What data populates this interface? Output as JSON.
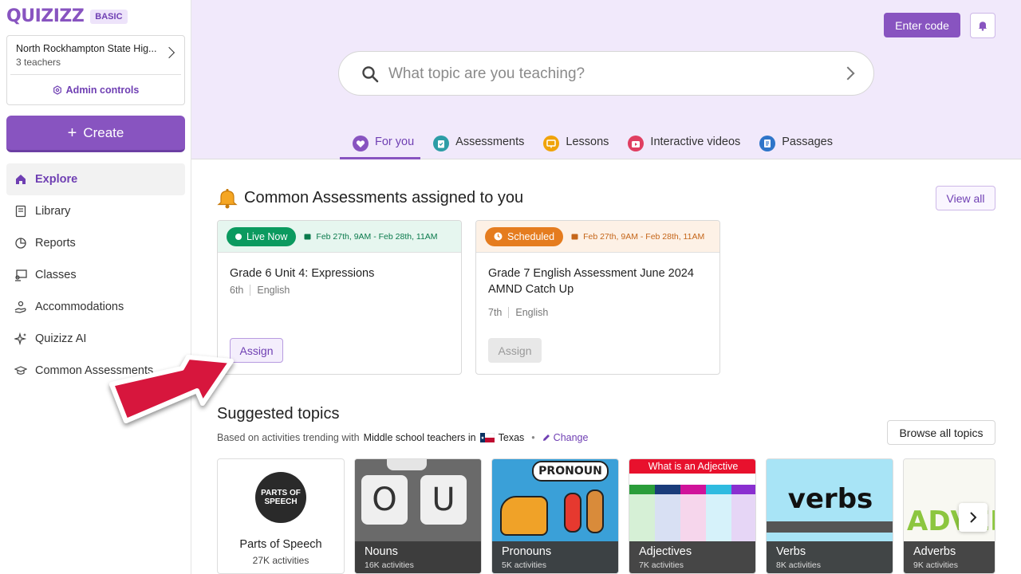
{
  "sidebar": {
    "logo": "QUIZIZZ",
    "plan": "BASIC",
    "org": {
      "name": "North Rockhampton State Hig...",
      "teachers": "3 teachers",
      "admin_label": "Admin controls"
    },
    "create_label": "Create",
    "items": [
      {
        "label": "Explore",
        "icon": "home-icon"
      },
      {
        "label": "Library",
        "icon": "library-icon"
      },
      {
        "label": "Reports",
        "icon": "reports-icon"
      },
      {
        "label": "Classes",
        "icon": "classes-icon"
      },
      {
        "label": "Accommodations",
        "icon": "accommodations-icon"
      },
      {
        "label": "Quizizz AI",
        "icon": "sparkle-icon"
      },
      {
        "label": "Common Assessments",
        "icon": "graduation-cap-icon"
      }
    ]
  },
  "header": {
    "enter_code": "Enter code",
    "search_placeholder": "What topic are you teaching?",
    "tabs": [
      {
        "label": "For you",
        "color": "#8854c0"
      },
      {
        "label": "Assessments",
        "color": "#2d9da6"
      },
      {
        "label": "Lessons",
        "color": "#f0a30a"
      },
      {
        "label": "Interactive videos",
        "color": "#e03e61"
      },
      {
        "label": "Passages",
        "color": "#2e75c9"
      }
    ]
  },
  "assessments": {
    "title": "Common Assessments assigned to you",
    "view_all": "View all",
    "cards": [
      {
        "status": "Live Now",
        "dates": "Feb 27th, 9AM - Feb 28th, 11AM",
        "title": "Grade 6 Unit 4: Expressions",
        "grade": "6th",
        "subject": "English",
        "assign": "Assign"
      },
      {
        "status": "Scheduled",
        "dates": "Feb 27th, 9AM - Feb 28th, 11AM",
        "title": "Grade 7 English Assessment June 2024 AMND Catch Up",
        "grade": "7th",
        "subject": "English",
        "assign": "Assign"
      }
    ]
  },
  "suggested": {
    "title": "Suggested topics",
    "based_on": "Based on activities trending with",
    "audience": "Middle school teachers in",
    "location": "Texas",
    "change": "Change",
    "browse": "Browse all topics",
    "topics": [
      {
        "name": "Parts of Speech",
        "count": "27K activities",
        "image_text": "PARTS OF SPEECH"
      },
      {
        "name": "Nouns",
        "count": "16K activities"
      },
      {
        "name": "Pronouns",
        "count": "5K activities",
        "image_text": "PRONOUN"
      },
      {
        "name": "Adjectives",
        "count": "7K activities",
        "image_text": "What is an Adjective"
      },
      {
        "name": "Verbs",
        "count": "8K activities",
        "image_text": "verbs"
      },
      {
        "name": "Adverbs",
        "count": "9K activities",
        "image_text": "ADVERB"
      }
    ]
  },
  "colors": {
    "brand": "#8854c0",
    "live": "#0b9a5f",
    "scheduled": "#e57c1f"
  }
}
